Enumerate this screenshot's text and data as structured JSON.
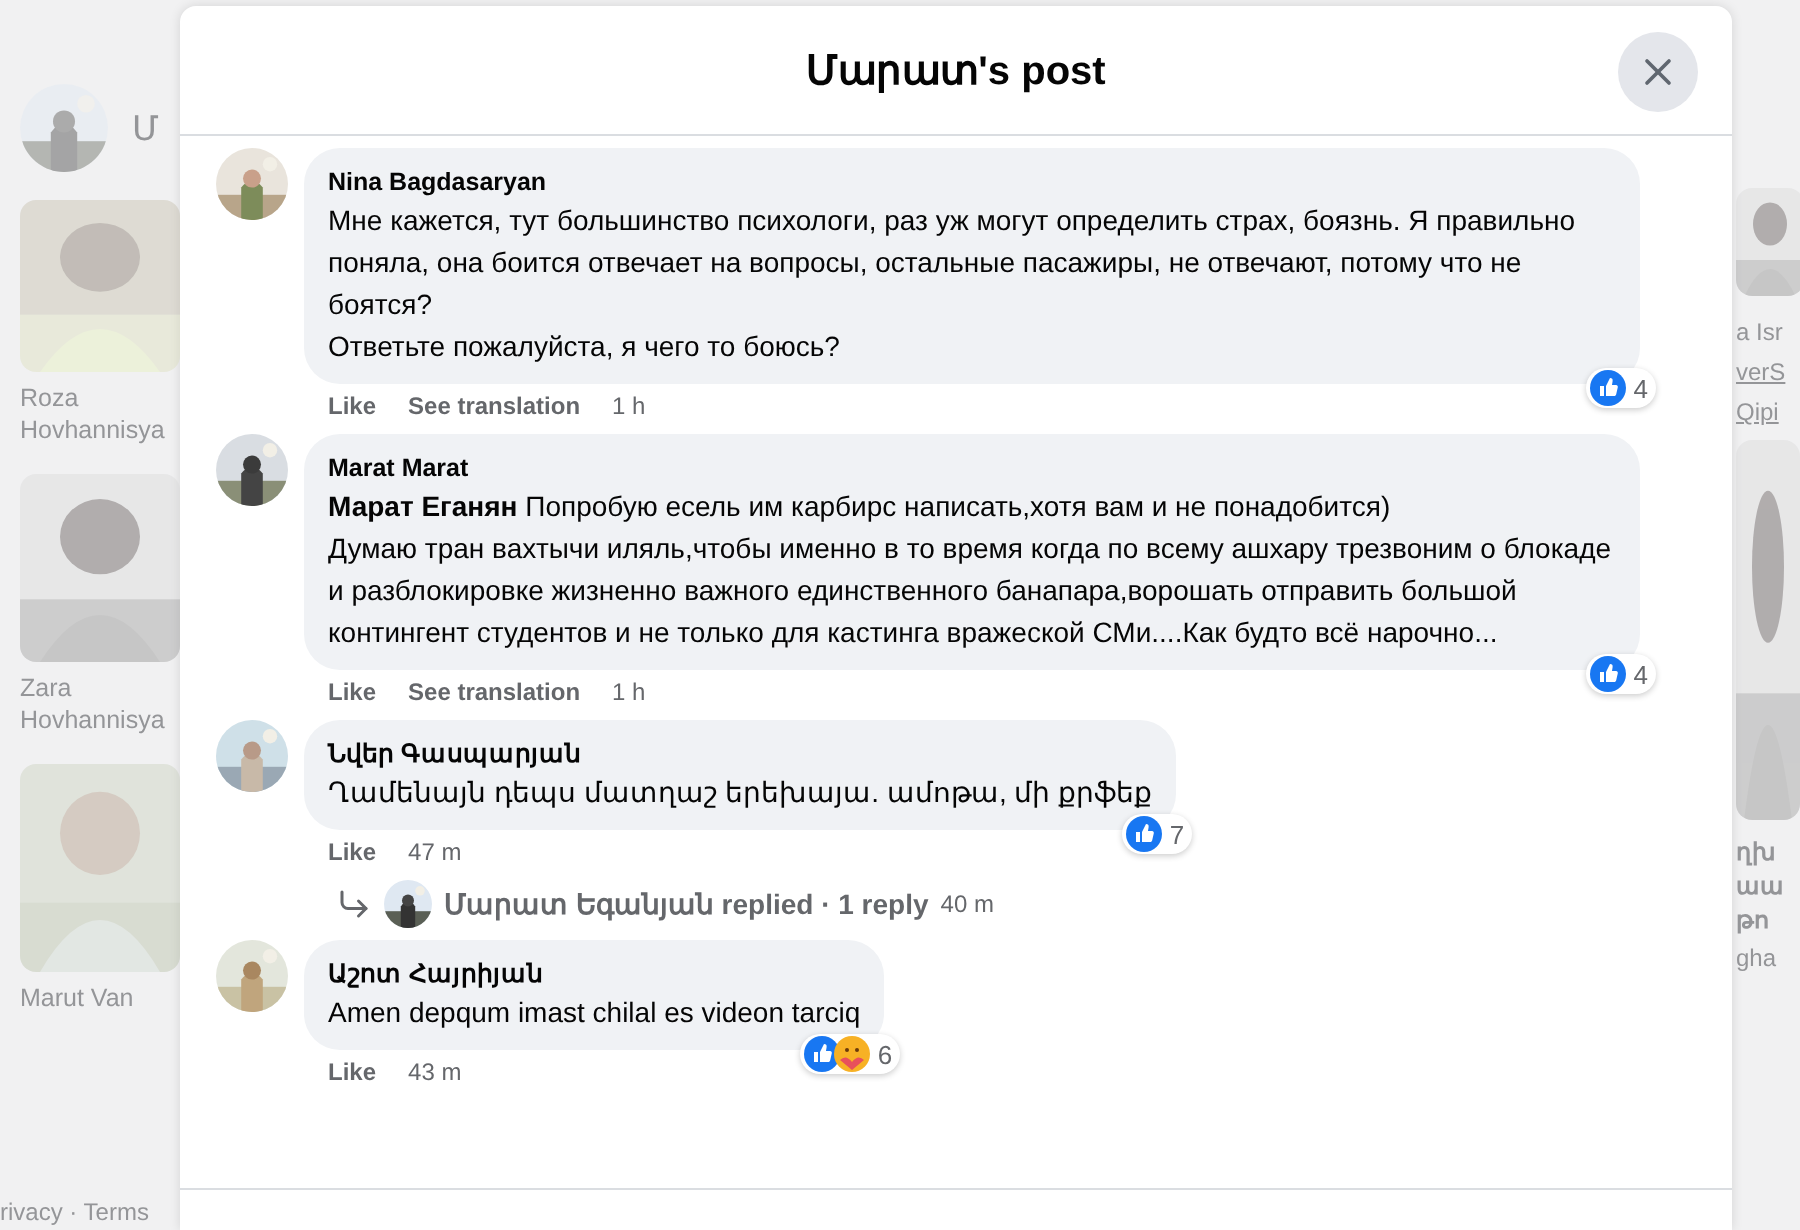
{
  "background": {
    "composer_text": "Մ",
    "left_people": [
      {
        "name": "Roza Hovhannisya"
      },
      {
        "name": "Zara Hovhannisya"
      },
      {
        "name": "Marut Van"
      }
    ],
    "right_texts": [
      {
        "text": "a Isr",
        "link": false
      },
      {
        "text": "verS",
        "link": true
      },
      {
        "text": "Qipi",
        "link": true
      }
    ],
    "right_lines": [
      "ղխ",
      "աա",
      "թո"
    ],
    "right_sub": "gha",
    "footer_links": "rivacy · Terms"
  },
  "modal": {
    "title": "Մարատ's post"
  },
  "comments": [
    {
      "author": "Nina Bagdasaryan",
      "text": "Мне кажется, тут большинство психологи, раз уж могут определить страх, боязнь. Я правильно поняла, она боится отвечает на вопросы, остальные пасажиры, не отвечают, потому что не боятся?\nОтветьте пожалуйста, я чего то боюсь?",
      "actions": [
        "Like",
        "See translation"
      ],
      "time": "1 h",
      "reactions": [
        {
          "kind": "like"
        }
      ],
      "count": "4"
    },
    {
      "author": "Marat Marat",
      "text": "**Марат Еганян** Попробую есель им карбирс написать,хотя вам и не понадобится)\nДумаю тран вахтычи иляль,чтобы именно в то время когда по всему ашхару трезвоним о блокаде и разблокировке жизненно важного единственного банапара,ворошать отправить большой контингент студентов и не только для кастинга вражеской СМи....Как будто всё нарочно...",
      "actions": [
        "Like",
        "See translation"
      ],
      "time": "1 h",
      "reactions": [
        {
          "kind": "like"
        }
      ],
      "count": "4"
    },
    {
      "author": "Նվեր Գասպարյան",
      "text": "Ղամենայն դեպս մատղաշ երեխայա. ամոթա, մի քրֆեք",
      "actions": [
        "Like"
      ],
      "time": "47 m",
      "reactions": [
        {
          "kind": "like"
        }
      ],
      "count": "7",
      "reply": {
        "label": "Մարատ Եգանյան replied · 1 reply",
        "time": "40 m"
      }
    },
    {
      "author": "Աշոտ Հայրիյան",
      "text": "Amen depqum imast chilal es videon tarciq",
      "actions": [
        "Like"
      ],
      "time": "43 m",
      "reactions": [
        {
          "kind": "like"
        },
        {
          "kind": "care"
        }
      ],
      "count": "6"
    }
  ]
}
